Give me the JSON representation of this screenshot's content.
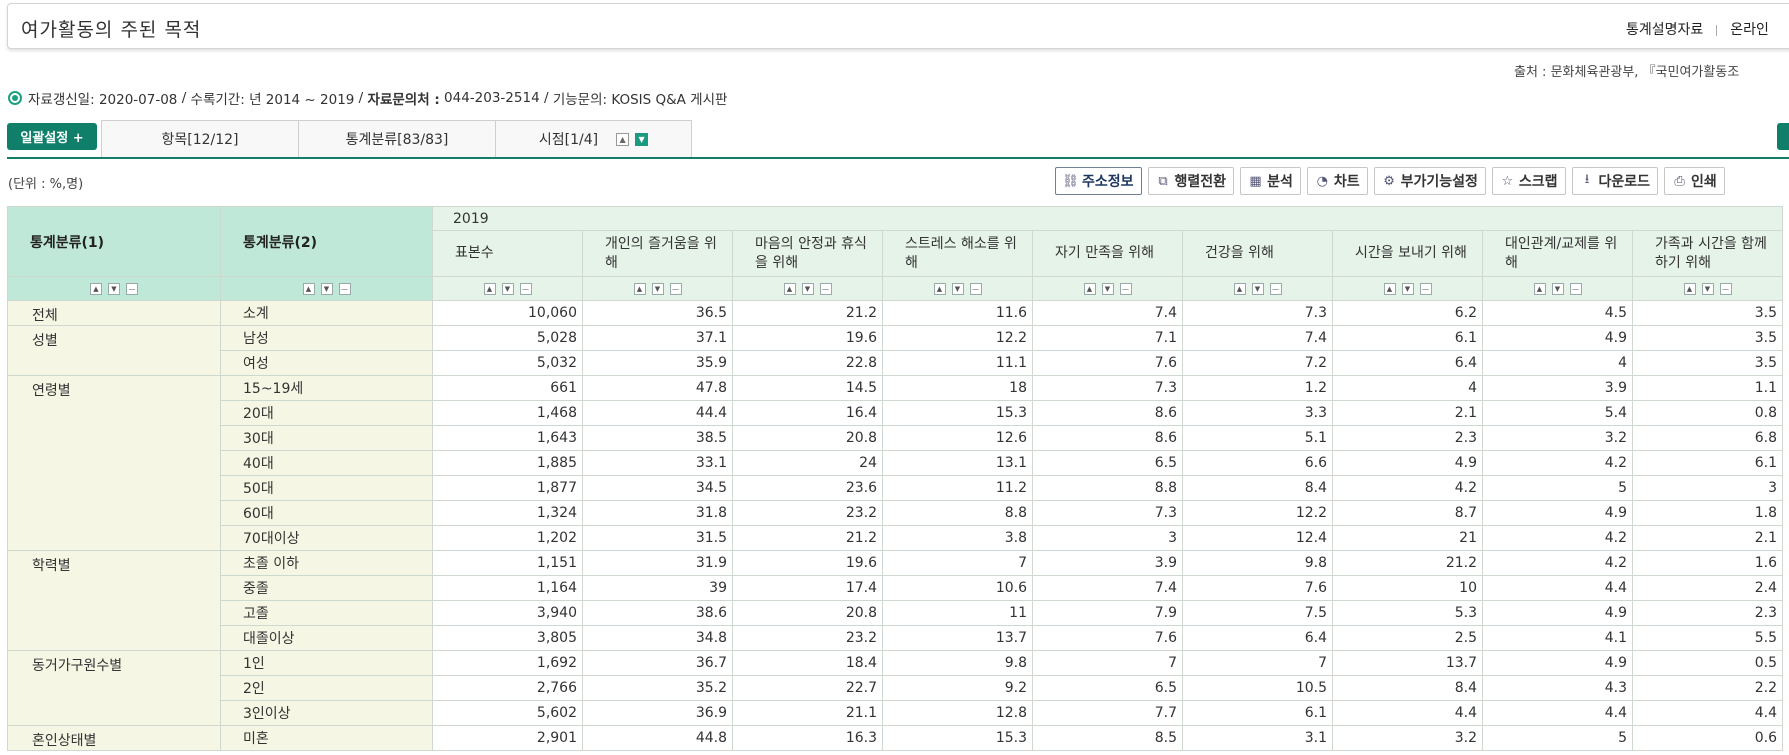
{
  "header": {
    "title": "여가활동의 주된 목적",
    "links": [
      "통계설명자료",
      "온라인"
    ]
  },
  "source": "출처 : 문화체육관광부, 『국민여가활동조",
  "info": {
    "updated": "자료갱신일: 2020-07-08",
    "period": "수록기간: 년 2014 ~ 2019",
    "contact_label": "자료문의처 :",
    "contact_value": "044-203-2514",
    "help": "기능문의: KOSIS Q&A 게시판"
  },
  "setup_button": "일괄설정 +",
  "tabs": [
    {
      "label": "항목[12/12]"
    },
    {
      "label": "통계분류[83/83]"
    },
    {
      "label": "시점[1/4]"
    }
  ],
  "unit": "(단위 : %,명)",
  "toolbar": [
    {
      "label": "주소정보",
      "icon": "link-icon"
    },
    {
      "label": "행렬전환",
      "icon": "swap-icon"
    },
    {
      "label": "분석",
      "icon": "analysis-icon"
    },
    {
      "label": "차트",
      "icon": "chart-icon"
    },
    {
      "label": "부가기능설정",
      "icon": "gear-icon"
    },
    {
      "label": "스크랩",
      "icon": "star-icon"
    },
    {
      "label": "다운로드",
      "icon": "download-icon"
    },
    {
      "label": "인쇄",
      "icon": "print-icon"
    }
  ],
  "table": {
    "cat1_header": "통계분류(1)",
    "cat2_header": "통계분류(2)",
    "year": "2019",
    "columns": [
      "표본수",
      "개인의 즐거움을 위해",
      "마음의 안정과 휴식을 위해",
      "스트레스 해소를 위해",
      "자기 만족을 위해",
      "건강을 위해",
      "시간을 보내기 위해",
      "대인관계/교제를 위해",
      "가족과 시간을 함께하기 위해"
    ],
    "groups": [
      {
        "name": "전체",
        "rows": [
          {
            "label": "소계",
            "values": [
              "10,060",
              "36.5",
              "21.2",
              "11.6",
              "7.4",
              "7.3",
              "6.2",
              "4.5",
              "3.5"
            ]
          }
        ]
      },
      {
        "name": "성별",
        "rows": [
          {
            "label": "남성",
            "values": [
              "5,028",
              "37.1",
              "19.6",
              "12.2",
              "7.1",
              "7.4",
              "6.1",
              "4.9",
              "3.5"
            ]
          },
          {
            "label": "여성",
            "values": [
              "5,032",
              "35.9",
              "22.8",
              "11.1",
              "7.6",
              "7.2",
              "6.4",
              "4",
              "3.5"
            ]
          }
        ]
      },
      {
        "name": "연령별",
        "rows": [
          {
            "label": "15~19세",
            "values": [
              "661",
              "47.8",
              "14.5",
              "18",
              "7.3",
              "1.2",
              "4",
              "3.9",
              "1.1"
            ]
          },
          {
            "label": "20대",
            "values": [
              "1,468",
              "44.4",
              "16.4",
              "15.3",
              "8.6",
              "3.3",
              "2.1",
              "5.4",
              "0.8"
            ]
          },
          {
            "label": "30대",
            "values": [
              "1,643",
              "38.5",
              "20.8",
              "12.6",
              "8.6",
              "5.1",
              "2.3",
              "3.2",
              "6.8"
            ]
          },
          {
            "label": "40대",
            "values": [
              "1,885",
              "33.1",
              "24",
              "13.1",
              "6.5",
              "6.6",
              "4.9",
              "4.2",
              "6.1"
            ]
          },
          {
            "label": "50대",
            "values": [
              "1,877",
              "34.5",
              "23.6",
              "11.2",
              "8.8",
              "8.4",
              "4.2",
              "5",
              "3"
            ]
          },
          {
            "label": "60대",
            "values": [
              "1,324",
              "31.8",
              "23.2",
              "8.8",
              "7.3",
              "12.2",
              "8.7",
              "4.9",
              "1.8"
            ]
          },
          {
            "label": "70대이상",
            "values": [
              "1,202",
              "31.5",
              "21.2",
              "3.8",
              "3",
              "12.4",
              "21",
              "4.2",
              "2.1"
            ]
          }
        ]
      },
      {
        "name": "학력별",
        "rows": [
          {
            "label": "초졸 이하",
            "values": [
              "1,151",
              "31.9",
              "19.6",
              "7",
              "3.9",
              "9.8",
              "21.2",
              "4.2",
              "1.6"
            ]
          },
          {
            "label": "중졸",
            "values": [
              "1,164",
              "39",
              "17.4",
              "10.6",
              "7.4",
              "7.6",
              "10",
              "4.4",
              "2.4"
            ]
          },
          {
            "label": "고졸",
            "values": [
              "3,940",
              "38.6",
              "20.8",
              "11",
              "7.9",
              "7.5",
              "5.3",
              "4.9",
              "2.3"
            ]
          },
          {
            "label": "대졸이상",
            "values": [
              "3,805",
              "34.8",
              "23.2",
              "13.7",
              "7.6",
              "6.4",
              "2.5",
              "4.1",
              "5.5"
            ]
          }
        ]
      },
      {
        "name": "동거가구원수별",
        "rows": [
          {
            "label": "1인",
            "values": [
              "1,692",
              "36.7",
              "18.4",
              "9.8",
              "7",
              "7",
              "13.7",
              "4.9",
              "0.5"
            ]
          },
          {
            "label": "2인",
            "values": [
              "2,766",
              "35.2",
              "22.7",
              "9.2",
              "6.5",
              "10.5",
              "8.4",
              "4.3",
              "2.2"
            ]
          },
          {
            "label": "3인이상",
            "values": [
              "5,602",
              "36.9",
              "21.1",
              "12.8",
              "7.7",
              "6.1",
              "4.4",
              "4.4",
              "4.4"
            ]
          }
        ]
      },
      {
        "name": "혼인상태별",
        "rows": [
          {
            "label": "미혼",
            "values": [
              "2,901",
              "44.8",
              "16.3",
              "15.3",
              "8.5",
              "3.1",
              "3.2",
              "5",
              "0.6"
            ]
          }
        ]
      }
    ]
  }
}
